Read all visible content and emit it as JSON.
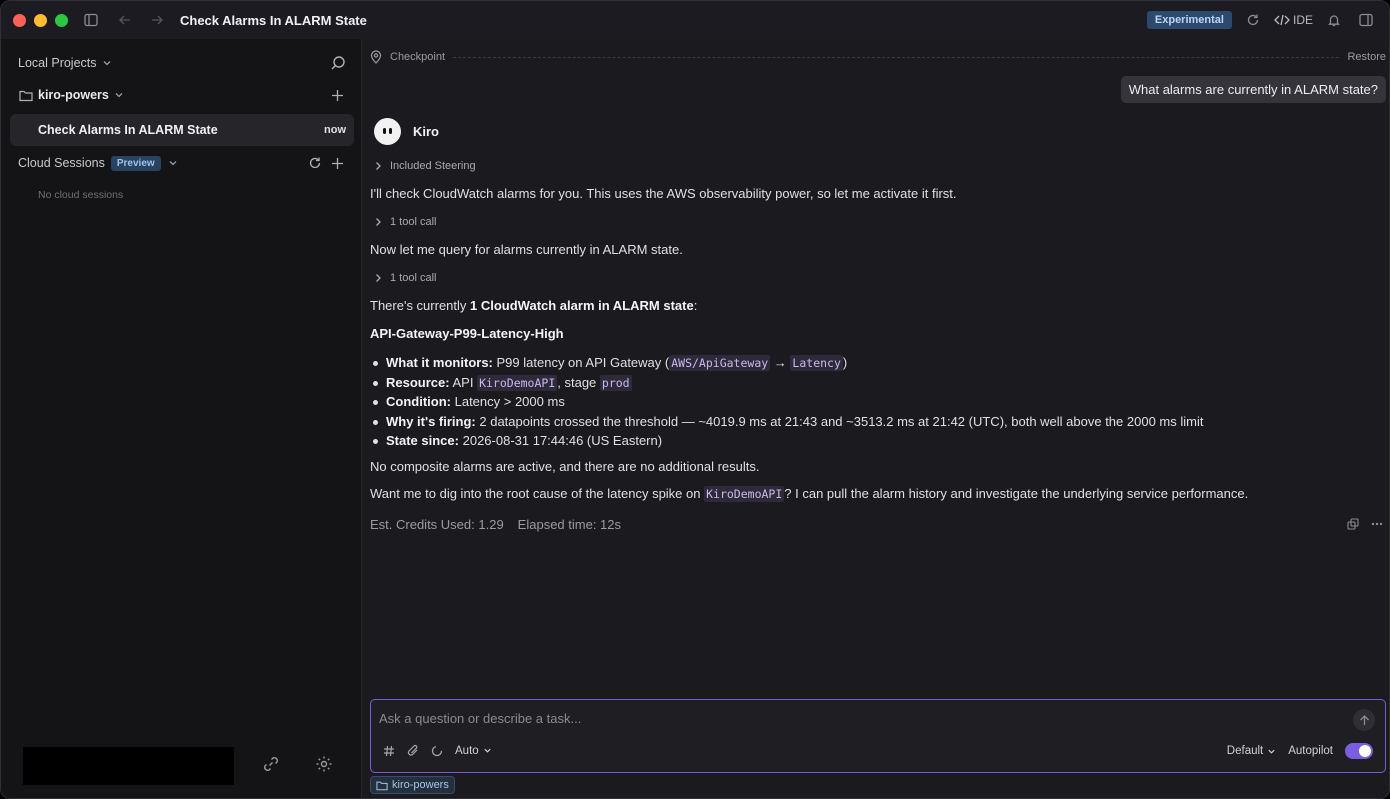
{
  "titlebar": {
    "title": "Check Alarms In ALARM State",
    "experimental_badge": "Experimental",
    "ide_label": "IDE"
  },
  "sidebar": {
    "local_projects_label": "Local Projects",
    "project_name": "kiro-powers",
    "active_session": {
      "label": "Check Alarms In ALARM State",
      "time": "now"
    },
    "cloud_sessions_label": "Cloud Sessions",
    "cloud_preview_badge": "Preview",
    "no_cloud_sessions": "No cloud sessions"
  },
  "chat": {
    "checkpoint_label": "Checkpoint",
    "restore_label": "Restore",
    "user_message": "What alarms are currently in ALARM state?",
    "assistant_name": "Kiro",
    "included_steering": "Included Steering",
    "msg1": "I'll check CloudWatch alarms for you. This uses the AWS observability power, so let me activate it first.",
    "tool_call_1": "1 tool call",
    "msg2": "Now let me query for alarms currently in ALARM state.",
    "tool_call_2": "1 tool call",
    "msg3_prefix": "There's currently ",
    "msg3_bold": "1 CloudWatch alarm in ALARM state",
    "msg3_suffix": ":",
    "alarm_name": "API-Gateway-P99-Latency-High",
    "bullets": {
      "monitors_label": "What it monitors:",
      "monitors_text": "P99 latency on API Gateway (",
      "monitors_code1": "AWS/ApiGateway",
      "monitors_arrow": "→",
      "monitors_code2": "Latency",
      "monitors_close": ")",
      "resource_label": "Resource:",
      "resource_text1": "API",
      "resource_code1": "KiroDemoAPI",
      "resource_text2": ", stage",
      "resource_code2": "prod",
      "condition_label": "Condition:",
      "condition_text": "Latency > 2000 ms",
      "firing_label": "Why it's firing:",
      "firing_text": "2 datapoints crossed the threshold — ~4019.9 ms at 21:43 and ~3513.2 ms at 21:42 (UTC), both well above the 2000 ms limit",
      "since_label": "State since:",
      "since_text": "2026-08-31 17:44:46 (US Eastern)"
    },
    "msg4": "No composite alarms are active, and there are no additional results.",
    "msg5_prefix": "Want me to dig into the root cause of the latency spike on ",
    "msg5_code": "KiroDemoAPI",
    "msg5_suffix": "? I can pull the alarm history and investigate the underlying service performance.",
    "credits": "Est. Credits Used: 1.29",
    "elapsed": "Elapsed time: 12s"
  },
  "composer": {
    "placeholder": "Ask a question or describe a task...",
    "mode": "Auto",
    "model": "Default",
    "autopilot_label": "Autopilot",
    "autopilot_on": true,
    "context_chip": "kiro-powers"
  },
  "colors": {
    "accent": "#7c5ce0",
    "code_text": "#c9b8f0",
    "badge_blue": "#2b4a6e"
  }
}
